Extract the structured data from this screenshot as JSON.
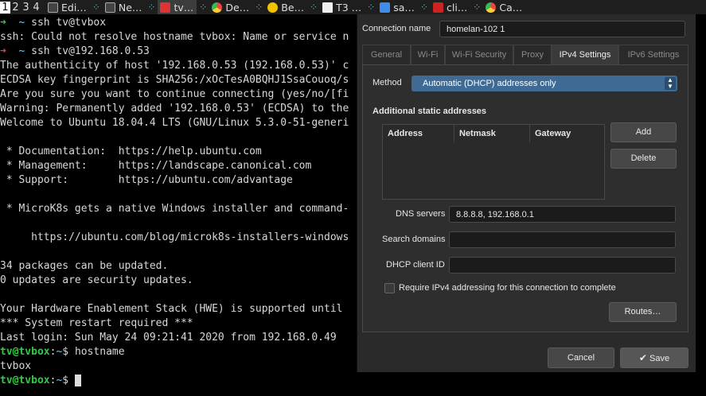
{
  "taskbar": {
    "workspaces": [
      "1",
      "2",
      "3",
      "4"
    ],
    "tasks": [
      {
        "label": "Edi…",
        "icon": "terminal-icon"
      },
      {
        "label": "Ne…",
        "icon": "terminal-icon"
      },
      {
        "label": "tv…",
        "icon": "red-app-icon"
      },
      {
        "label": "De…",
        "icon": "chrome-icon"
      },
      {
        "label": "Be…",
        "icon": "yellow-app-icon"
      },
      {
        "label": "T3 …",
        "icon": "document-icon"
      },
      {
        "label": "sa…",
        "icon": "folder-icon"
      },
      {
        "label": "cli…",
        "icon": "filezilla-icon"
      },
      {
        "label": "Ca…",
        "icon": "chrome-icon"
      }
    ]
  },
  "terminal": {
    "prompt_host": "tv@tvbox",
    "lines": [
      "ssh tv@tvbox",
      "ssh: Could not resolve hostname tvbox: Name or service n",
      "ssh tv@192.168.0.53",
      "The authenticity of host '192.168.0.53 (192.168.0.53)' c",
      "ECDSA key fingerprint is SHA256:/xOcTesA0BQHJ1SsaCouoq/s",
      "Are you sure you want to continue connecting (yes/no/[fi",
      "Warning: Permanently added '192.168.0.53' (ECDSA) to the",
      "Welcome to Ubuntu 18.04.4 LTS (GNU/Linux 5.3.0-51-generi",
      "",
      " * Documentation:  https://help.ubuntu.com",
      " * Management:     https://landscape.canonical.com",
      " * Support:        https://ubuntu.com/advantage",
      "",
      " * MicroK8s gets a native Windows installer and command-",
      "",
      "     https://ubuntu.com/blog/microk8s-installers-windows",
      "",
      "34 packages can be updated.",
      "0 updates are security updates.",
      "",
      "Your Hardware Enablement Stack (HWE) is supported until",
      "*** System restart required ***",
      "Last login: Sun May 24 09:21:41 2020 from 192.168.0.49",
      "hostname",
      "tvbox"
    ]
  },
  "dialog": {
    "connection_name_label": "Connection name",
    "connection_name_value": "homelan-102 1",
    "tabs": [
      "General",
      "Wi-Fi",
      "Wi-Fi Security",
      "Proxy",
      "IPv4 Settings",
      "IPv6 Settings"
    ],
    "active_tab": "IPv4 Settings",
    "method_label": "Method",
    "method_value": "Automatic (DHCP) addresses only",
    "additional_static_label": "Additional static addresses",
    "table_columns": [
      "Address",
      "Netmask",
      "Gateway"
    ],
    "add_label": "Add",
    "delete_label": "Delete",
    "dns_label": "DNS servers",
    "dns_value": "8.8.8.8, 192.168.0.1",
    "search_domains_label": "Search domains",
    "search_domains_value": "",
    "dhcp_client_id_label": "DHCP client ID",
    "dhcp_client_id_value": "",
    "require_ipv4_label": "Require IPv4 addressing for this connection to complete",
    "require_ipv4_checked": false,
    "routes_label": "Routes…",
    "cancel_label": "Cancel",
    "save_label": "Save"
  },
  "colors": {
    "terminal_bg": "#000000",
    "prompt_green": "#2ecc40",
    "prompt_red": "#e8453c",
    "dialog_bg": "#2a2a2a",
    "select_accent": "#3f6a93"
  }
}
